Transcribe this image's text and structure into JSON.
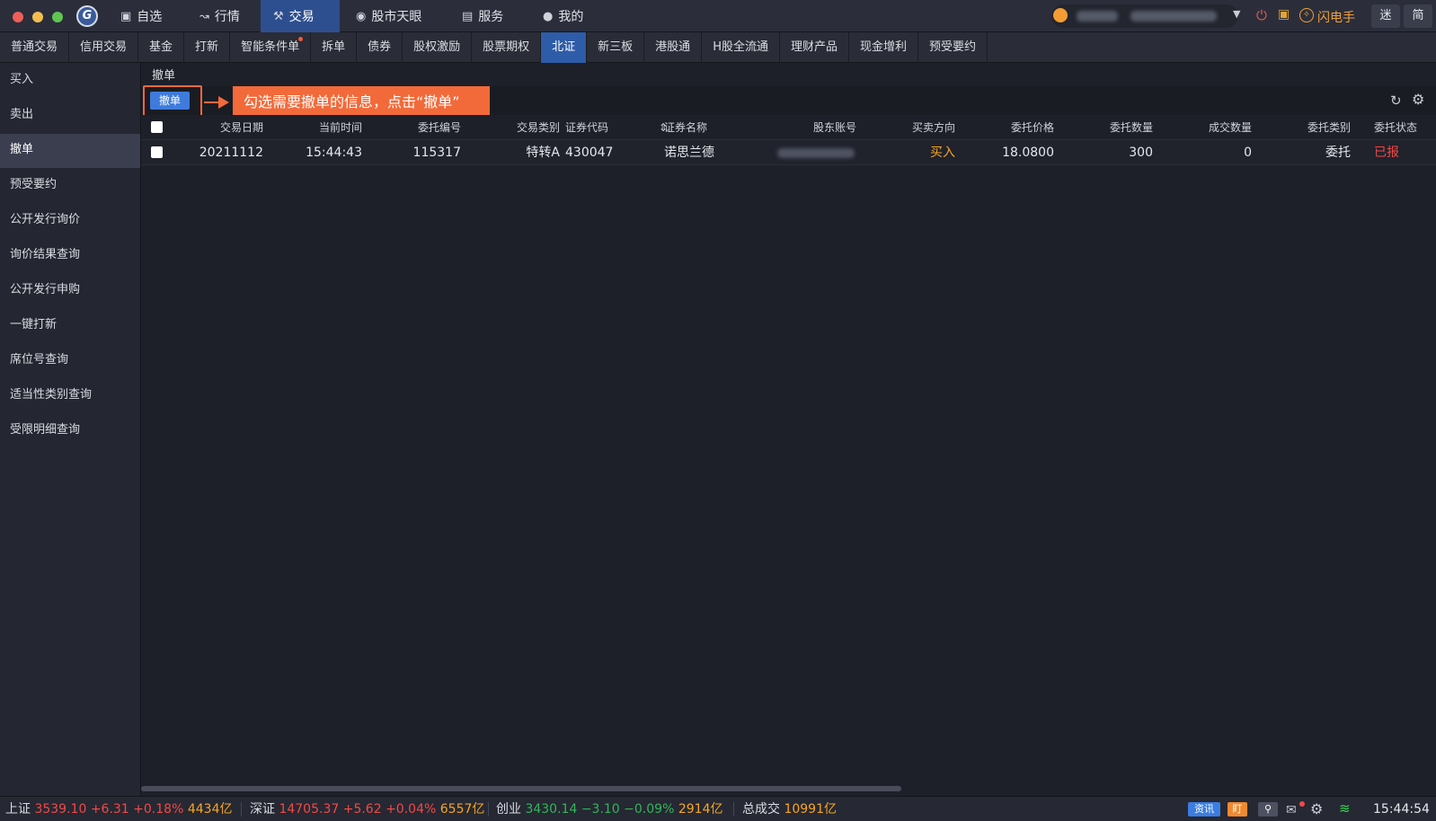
{
  "topnav": {
    "favorites": "自选",
    "quotes": "行情",
    "trade": "交易",
    "skyeye": "股市天眼",
    "service": "服务",
    "mine": "我的",
    "flash": "闪电手",
    "mini": "迷",
    "simple": "简"
  },
  "tabs": [
    "普通交易",
    "信用交易",
    "基金",
    "打新",
    "智能条件单",
    "拆单",
    "债券",
    "股权激励",
    "股票期权",
    "北证",
    "新三板",
    "港股通",
    "H股全流通",
    "理财产品",
    "现金增利",
    "预受要约"
  ],
  "active_tab": "北证",
  "sidebar": {
    "items": [
      "买入",
      "卖出",
      "撤单",
      "预受要约",
      "公开发行询价",
      "询价结果查询",
      "公开发行申购",
      "一键打新",
      "席位号查询",
      "适当性类别查询",
      "受限明细查询"
    ],
    "active": "撤单"
  },
  "main": {
    "section_title": "撤单",
    "cancel_button": "撤单",
    "callout": "勾选需要撤单的信息，点击“撤单”"
  },
  "table": {
    "headers": {
      "date": "交易日期",
      "time": "当前时间",
      "order_no": "委托编号",
      "trade_type": "交易类别",
      "code": "证券代码",
      "name": "证券名称",
      "account": "股东账号",
      "direction": "买卖方向",
      "price": "委托价格",
      "qty": "委托数量",
      "filled": "成交数量",
      "order_type": "委托类别",
      "status": "委托状态"
    },
    "rows": [
      {
        "date": "20211112",
        "time": "15:44:43",
        "order_no": "115317",
        "trade_type": "特转A",
        "code": "430047",
        "name": "诺思兰德",
        "direction": "买入",
        "price": "18.0800",
        "qty": "300",
        "filled": "0",
        "order_type": "委托",
        "status": "已报"
      }
    ]
  },
  "statusbar": {
    "sh": {
      "label": "上证",
      "value": "3539.10",
      "change": "+6.31",
      "pct": "+0.18%",
      "turnover": "4434亿"
    },
    "sz": {
      "label": "深证",
      "value": "14705.37",
      "change": "+5.62",
      "pct": "+0.04%",
      "turnover": "6557亿"
    },
    "cy": {
      "label": "创业",
      "value": "3430.14",
      "change": "−3.10",
      "pct": "−0.09%",
      "turnover": "2914亿"
    },
    "total": {
      "label": "总成交",
      "value": "10991亿"
    },
    "news": "资讯",
    "ding": "盯",
    "time": "15:44:54"
  },
  "colors": {
    "accent": "#2e5ca8",
    "callout": "#f26a3a",
    "up": "#f04a46",
    "down": "#32b55a",
    "buy": "#f5a623"
  },
  "icons": {
    "favorites": "star-square-icon",
    "quotes": "chart-icon",
    "trade": "gavel-icon",
    "skyeye": "eye-icon",
    "service": "briefcase-icon",
    "mine": "user-icon"
  }
}
